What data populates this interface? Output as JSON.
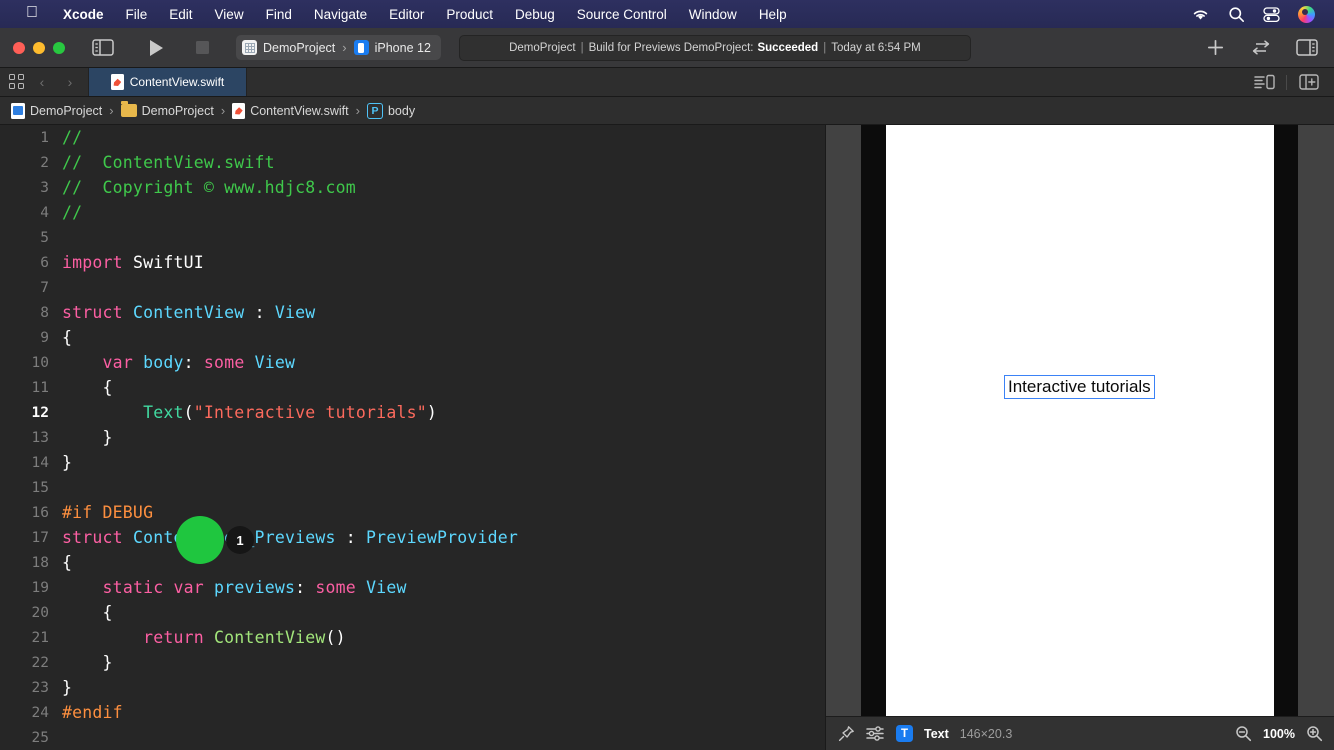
{
  "menubar": {
    "apple_icon": "apple-logo-icon",
    "items": [
      {
        "label": "Xcode",
        "bold": true
      },
      {
        "label": "File",
        "bold": false
      },
      {
        "label": "Edit",
        "bold": false
      },
      {
        "label": "View",
        "bold": false
      },
      {
        "label": "Find",
        "bold": false
      },
      {
        "label": "Navigate",
        "bold": false
      },
      {
        "label": "Editor",
        "bold": false
      },
      {
        "label": "Product",
        "bold": false
      },
      {
        "label": "Debug",
        "bold": false
      },
      {
        "label": "Source Control",
        "bold": false
      },
      {
        "label": "Window",
        "bold": false
      },
      {
        "label": "Help",
        "bold": false
      }
    ],
    "status_icons": [
      "wifi-icon",
      "search-icon",
      "control-center-icon",
      "user-avatar-icon"
    ],
    "background_color": "#2b2d5e"
  },
  "toolbar": {
    "window_controls": [
      "close-button",
      "minimize-button",
      "zoom-button"
    ],
    "sidebar_toggle": "sidebar-toggle-icon",
    "run_button": "run-play-icon",
    "stop_button": "stop-square-icon",
    "scheme": {
      "project": "DemoProject",
      "separator": "›",
      "destination": "iPhone 12"
    },
    "status": {
      "project": "DemoProject",
      "pipe": "|",
      "action": "Build for Previews DemoProject:",
      "result": "Succeeded",
      "time": "Today at 6:54 PM"
    },
    "right_icons": [
      "add-icon",
      "swap-editors-icon",
      "inspector-toggle-icon"
    ]
  },
  "tabbar": {
    "grid_icon": "tab-grid-icon",
    "back_chevron": "‹",
    "forward_chevron": "›",
    "active_tab": {
      "icon": "swift-file-icon",
      "label": "ContentView.swift"
    },
    "right_icons": [
      "editor-options-icon",
      "add-editor-icon"
    ]
  },
  "breadcrumb": {
    "items": [
      {
        "icon": "xcode-project-icon",
        "label": "DemoProject"
      },
      {
        "icon": "folder-icon",
        "label": "DemoProject"
      },
      {
        "icon": "swift-file-icon",
        "label": "ContentView.swift"
      },
      {
        "icon": "property-badge-icon",
        "badge": "P",
        "label": "body"
      }
    ],
    "separator": "›"
  },
  "editor": {
    "lines": [
      {
        "n": "1",
        "current": false,
        "tokens": [
          {
            "t": "//",
            "c": "cm"
          }
        ]
      },
      {
        "n": "2",
        "current": false,
        "tokens": [
          {
            "t": "//  ContentView.swift",
            "c": "cm"
          }
        ]
      },
      {
        "n": "3",
        "current": false,
        "tokens": [
          {
            "t": "//  Copyright © www.hdjc8.com",
            "c": "cm"
          }
        ]
      },
      {
        "n": "4",
        "current": false,
        "tokens": [
          {
            "t": "//",
            "c": "cm"
          }
        ]
      },
      {
        "n": "5",
        "current": false,
        "tokens": []
      },
      {
        "n": "6",
        "current": false,
        "tokens": [
          {
            "t": "import",
            "c": "kw"
          },
          {
            "t": " SwiftUI",
            "c": "pl"
          }
        ]
      },
      {
        "n": "7",
        "current": false,
        "tokens": []
      },
      {
        "n": "8",
        "current": false,
        "tokens": [
          {
            "t": "struct",
            "c": "kw"
          },
          {
            "t": " ",
            "c": "pl"
          },
          {
            "t": "ContentView",
            "c": "ty"
          },
          {
            "t": " : ",
            "c": "pl"
          },
          {
            "t": "View",
            "c": "ty"
          }
        ]
      },
      {
        "n": "9",
        "current": false,
        "tokens": [
          {
            "t": "{",
            "c": "pl"
          }
        ]
      },
      {
        "n": "10",
        "current": false,
        "tokens": [
          {
            "t": "    ",
            "c": "pl"
          },
          {
            "t": "var",
            "c": "kw"
          },
          {
            "t": " ",
            "c": "pl"
          },
          {
            "t": "body",
            "c": "ty"
          },
          {
            "t": ": ",
            "c": "pl"
          },
          {
            "t": "some",
            "c": "kw"
          },
          {
            "t": " ",
            "c": "pl"
          },
          {
            "t": "View",
            "c": "ty"
          }
        ]
      },
      {
        "n": "11",
        "current": false,
        "tokens": [
          {
            "t": "    {",
            "c": "pl"
          }
        ]
      },
      {
        "n": "12",
        "current": true,
        "tokens": [
          {
            "t": "        ",
            "c": "pl"
          },
          {
            "t": "Text",
            "c": "fn"
          },
          {
            "t": "(",
            "c": "pl"
          },
          {
            "t": "\"",
            "c": "st"
          },
          {
            "t": "Interactive tutorials",
            "c": "st"
          },
          {
            "t": "\"",
            "c": "st"
          },
          {
            "t": ")",
            "c": "pl"
          }
        ]
      },
      {
        "n": "13",
        "current": false,
        "tokens": [
          {
            "t": "    }",
            "c": "pl"
          }
        ]
      },
      {
        "n": "14",
        "current": false,
        "tokens": [
          {
            "t": "}",
            "c": "pl"
          }
        ]
      },
      {
        "n": "15",
        "current": false,
        "tokens": []
      },
      {
        "n": "16",
        "current": false,
        "tokens": [
          {
            "t": "#if DEBUG",
            "c": "pp"
          }
        ]
      },
      {
        "n": "17",
        "current": false,
        "tokens": [
          {
            "t": "struct",
            "c": "kw"
          },
          {
            "t": " ",
            "c": "pl"
          },
          {
            "t": "ContentView_Previews",
            "c": "ty"
          },
          {
            "t": " : ",
            "c": "pl"
          },
          {
            "t": "PreviewProvider",
            "c": "ty"
          }
        ]
      },
      {
        "n": "18",
        "current": false,
        "tokens": [
          {
            "t": "{",
            "c": "pl"
          }
        ]
      },
      {
        "n": "19",
        "current": false,
        "tokens": [
          {
            "t": "    ",
            "c": "pl"
          },
          {
            "t": "static",
            "c": "kw"
          },
          {
            "t": " ",
            "c": "pl"
          },
          {
            "t": "var",
            "c": "kw"
          },
          {
            "t": " ",
            "c": "pl"
          },
          {
            "t": "previews",
            "c": "ty"
          },
          {
            "t": ": ",
            "c": "pl"
          },
          {
            "t": "some",
            "c": "kw"
          },
          {
            "t": " ",
            "c": "pl"
          },
          {
            "t": "View",
            "c": "ty"
          }
        ]
      },
      {
        "n": "20",
        "current": false,
        "tokens": [
          {
            "t": "    {",
            "c": "pl"
          }
        ]
      },
      {
        "n": "21",
        "current": false,
        "tokens": [
          {
            "t": "        ",
            "c": "pl"
          },
          {
            "t": "return",
            "c": "kw"
          },
          {
            "t": " ",
            "c": "pl"
          },
          {
            "t": "ContentView",
            "c": "ct"
          },
          {
            "t": "()",
            "c": "pl"
          }
        ]
      },
      {
        "n": "22",
        "current": false,
        "tokens": [
          {
            "t": "    }",
            "c": "pl"
          }
        ]
      },
      {
        "n": "23",
        "current": false,
        "tokens": [
          {
            "t": "}",
            "c": "pl"
          }
        ]
      },
      {
        "n": "24",
        "current": false,
        "tokens": [
          {
            "t": "#endif",
            "c": "pp"
          }
        ]
      },
      {
        "n": "25",
        "current": false,
        "tokens": []
      }
    ],
    "annotations": {
      "click_marker_color": "#1fc63f",
      "click_badge_number": "1"
    },
    "syntax_colors": {
      "comment": "#3fc84b",
      "keyword": "#fc5fa3",
      "type": "#5dd8ff",
      "string": "#fc6a5d",
      "function": "#41d9a0",
      "constructor": "#a2e57b",
      "preprocessor": "#fd8f3f",
      "plain": "#ffffff",
      "background": "#262626"
    }
  },
  "canvas": {
    "preview_text": "Interactive tutorials",
    "selection_color": "#3b82f6",
    "bottombar": {
      "pin_icon": "pin-icon",
      "settings_icon": "preview-settings-icon",
      "element_badge": "T",
      "element_name": "Text",
      "element_size": "146×20.3",
      "zoom_out_icon": "zoom-out-icon",
      "zoom_level": "100%",
      "zoom_in_icon": "zoom-in-icon"
    }
  }
}
